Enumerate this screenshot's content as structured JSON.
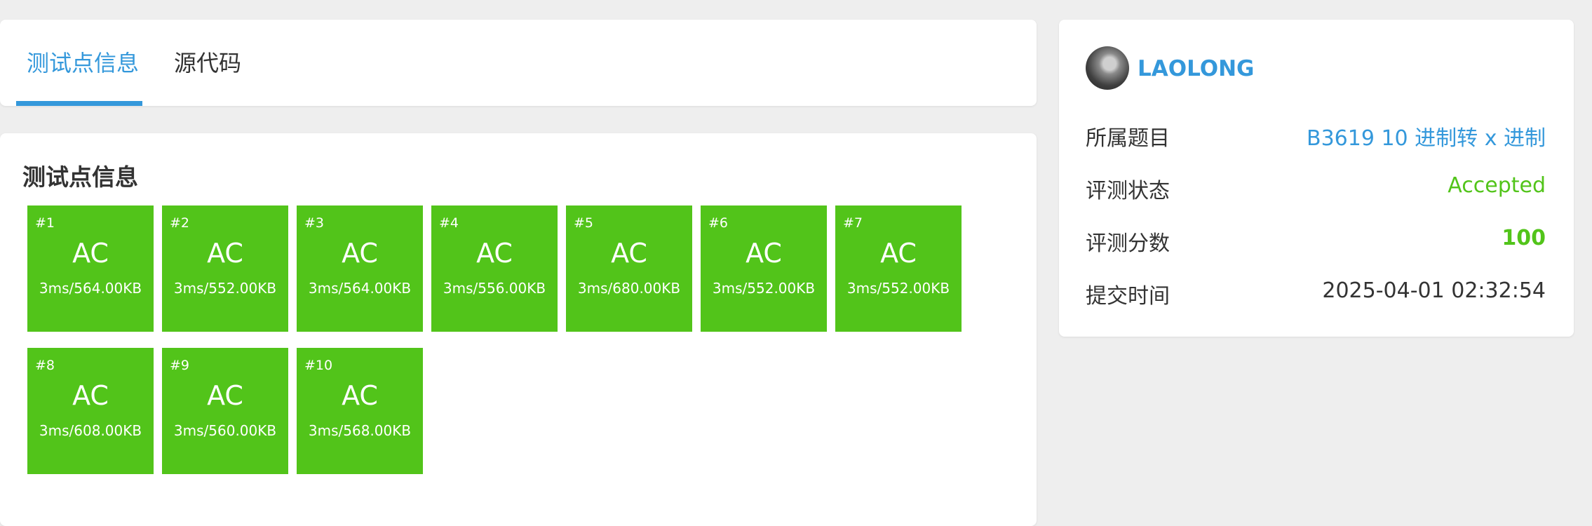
{
  "tabs": {
    "items": [
      {
        "label": "测试点信息",
        "active": true
      },
      {
        "label": "源代码",
        "active": false
      }
    ]
  },
  "testpoints": {
    "title": "测试点信息",
    "items": [
      {
        "num": "#1",
        "status": "AC",
        "meta": "3ms/564.00KB"
      },
      {
        "num": "#2",
        "status": "AC",
        "meta": "3ms/552.00KB"
      },
      {
        "num": "#3",
        "status": "AC",
        "meta": "3ms/564.00KB"
      },
      {
        "num": "#4",
        "status": "AC",
        "meta": "3ms/556.00KB"
      },
      {
        "num": "#5",
        "status": "AC",
        "meta": "3ms/680.00KB"
      },
      {
        "num": "#6",
        "status": "AC",
        "meta": "3ms/552.00KB"
      },
      {
        "num": "#7",
        "status": "AC",
        "meta": "3ms/552.00KB"
      },
      {
        "num": "#8",
        "status": "AC",
        "meta": "3ms/608.00KB"
      },
      {
        "num": "#9",
        "status": "AC",
        "meta": "3ms/560.00KB"
      },
      {
        "num": "#10",
        "status": "AC",
        "meta": "3ms/568.00KB"
      }
    ]
  },
  "info": {
    "username": "LAOLONG",
    "problem_label": "所属题目",
    "problem_value": "B3619 10 进制转 x 进制",
    "status_label": "评测状态",
    "status_value": "Accepted",
    "score_label": "评测分数",
    "score_value": "100",
    "time_label": "提交时间",
    "time_value": "2025-04-01 02:32:54"
  },
  "colors": {
    "accent": "#3498db",
    "accepted": "#52c41a",
    "background": "#eeeeee"
  }
}
